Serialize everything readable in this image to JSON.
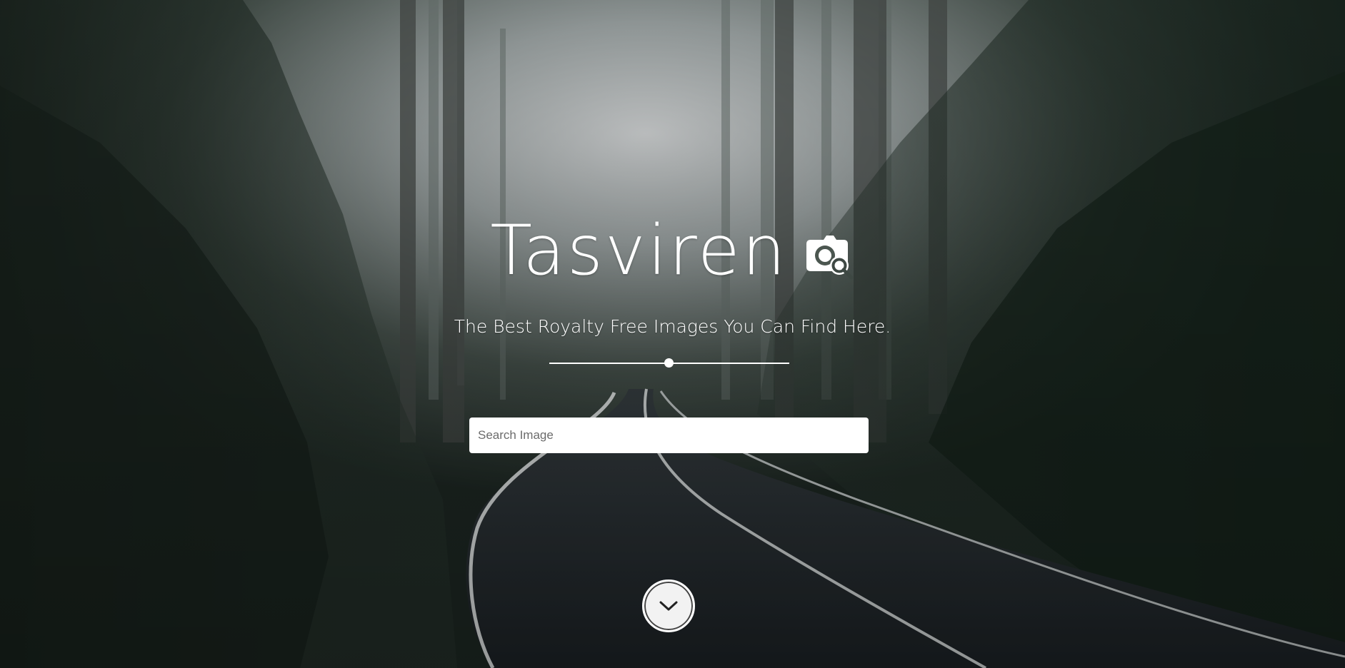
{
  "hero": {
    "title": "Tasviren",
    "subtitle": "The Best Royalty Free Images You Can Find Here.",
    "background_image": "misty-forest-road-photo"
  },
  "search": {
    "placeholder": "Search Image",
    "value": ""
  },
  "icons": {
    "logo_icon": "camera-search-icon",
    "scroll_icon": "chevron-down-icon"
  },
  "colors": {
    "text": "#ffffff",
    "search_bg": "#ffffff",
    "scroll_button_bg": "#f2f2f2"
  }
}
